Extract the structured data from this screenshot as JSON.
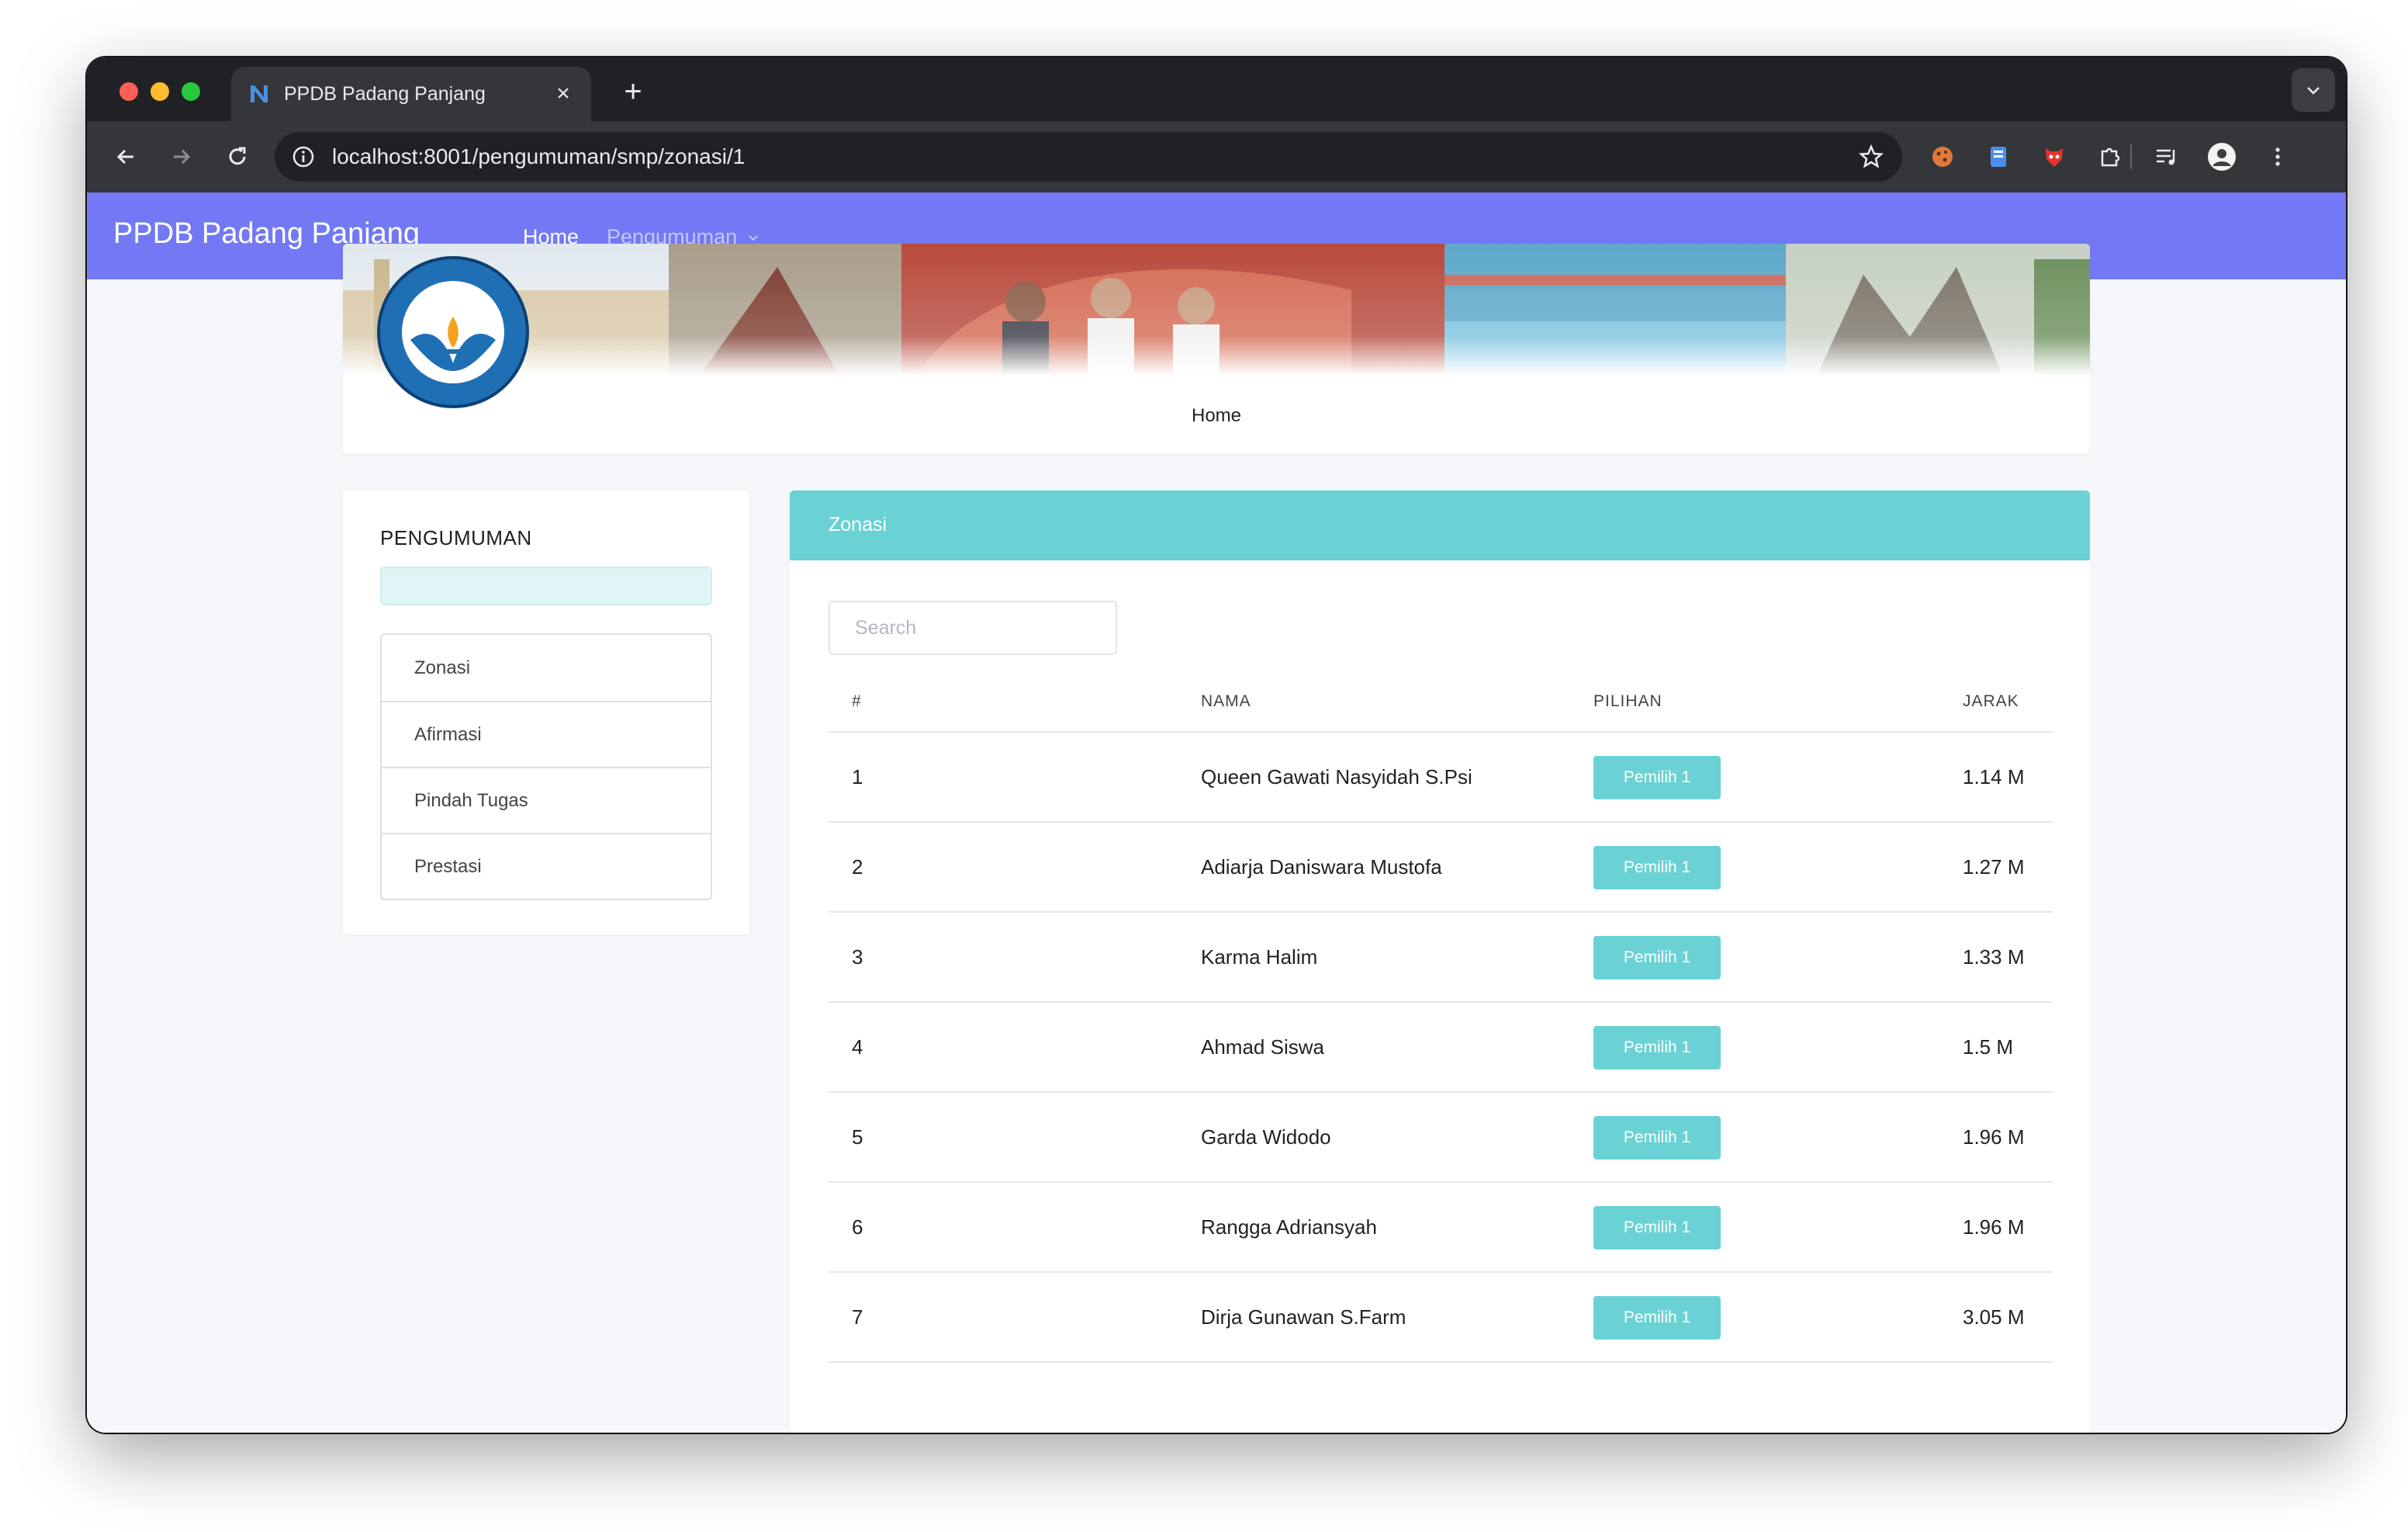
{
  "browser": {
    "tab_title": "PPDB Padang Panjang",
    "url": "localhost:8001/pengumuman/smp/zonasi/1"
  },
  "navbar": {
    "brand": "PPDB Padang Panjang",
    "home": "Home",
    "pengumuman": "Pengumuman"
  },
  "banner": {
    "logo_text": "TUT WURI HANDAYANI",
    "caption": "Home"
  },
  "sidebar": {
    "title": "PENGUMUMAN",
    "items": [
      {
        "label": "Zonasi"
      },
      {
        "label": "Afirmasi"
      },
      {
        "label": "Pindah Tugas"
      },
      {
        "label": "Prestasi"
      }
    ]
  },
  "main": {
    "title": "Zonasi",
    "search_placeholder": "Search",
    "columns": {
      "num": "#",
      "nama": "NAMA",
      "pilihan": "PILIHAN",
      "jarak": "JARAK"
    },
    "rows": [
      {
        "num": "1",
        "nama": "Queen Gawati Nasyidah S.Psi",
        "pilihan": "Pemilih 1",
        "jarak": "1.14 M"
      },
      {
        "num": "2",
        "nama": "Adiarja Daniswara Mustofa",
        "pilihan": "Pemilih 1",
        "jarak": "1.27 M"
      },
      {
        "num": "3",
        "nama": "Karma Halim",
        "pilihan": "Pemilih 1",
        "jarak": "1.33 M"
      },
      {
        "num": "4",
        "nama": "Ahmad Siswa",
        "pilihan": "Pemilih 1",
        "jarak": "1.5 M"
      },
      {
        "num": "5",
        "nama": "Garda Widodo",
        "pilihan": "Pemilih 1",
        "jarak": "1.96 M"
      },
      {
        "num": "6",
        "nama": "Rangga Adriansyah",
        "pilihan": "Pemilih 1",
        "jarak": "1.96 M"
      },
      {
        "num": "7",
        "nama": "Dirja Gunawan S.Farm",
        "pilihan": "Pemilih 1",
        "jarak": "3.05 M"
      }
    ]
  },
  "colors": {
    "navbar": "#7379f4",
    "accent_teal": "#6ad2d4"
  }
}
